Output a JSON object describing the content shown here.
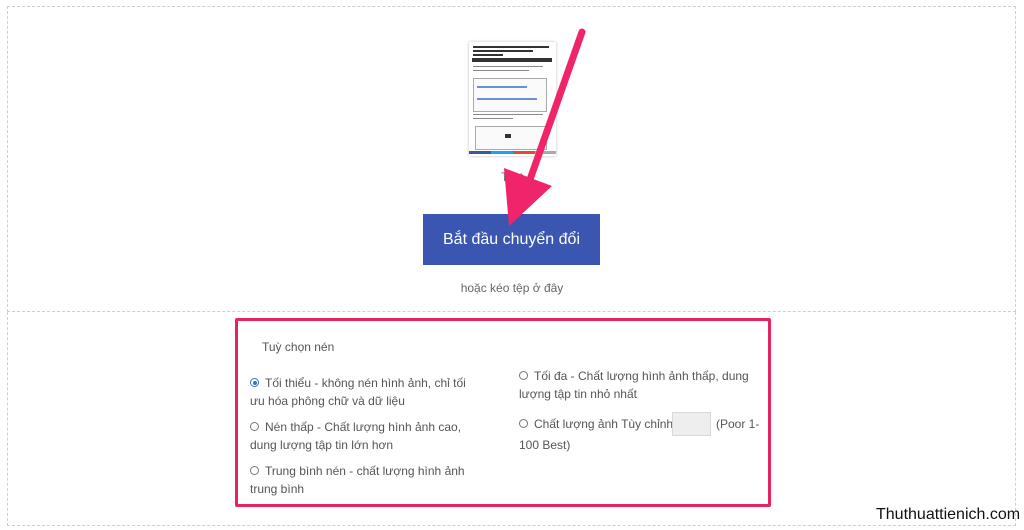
{
  "upload": {
    "file_name": "Test",
    "convert_button": "Bắt đầu chuyển đổi",
    "drop_hint": "hoặc kéo tệp ở đây"
  },
  "compression": {
    "title": "Tuỳ chọn nén",
    "options": [
      {
        "label_line1": "Tối thiểu - không nén hình ảnh, chỉ tối",
        "label_line2": "ưu hóa phông chữ và dữ liệu",
        "selected": true
      },
      {
        "label_line1": "Nén thấp - Chất lượng hình ảnh cao,",
        "label_line2": "dung lượng tập tin lớn hơn",
        "selected": false
      },
      {
        "label_line1": "Trung bình nén - chất lượng hình ảnh",
        "label_line2": "trung bình",
        "selected": false
      },
      {
        "label_line1": "Tối đa - Chất lượng hình ảnh thấp, dung",
        "label_line2": "lượng tập tin nhỏ nhất",
        "selected": false
      },
      {
        "label_line1": "Chất lượng ảnh Tùy chỉnh",
        "label_line2": "100 Best)",
        "selected": false
      }
    ],
    "custom_quality_hint": "(Poor 1-"
  },
  "watermark": "Thuthuattienich.com",
  "colors": {
    "button": "#3a56b0",
    "highlight": "#e8245e",
    "arrow": "#f0246a"
  }
}
